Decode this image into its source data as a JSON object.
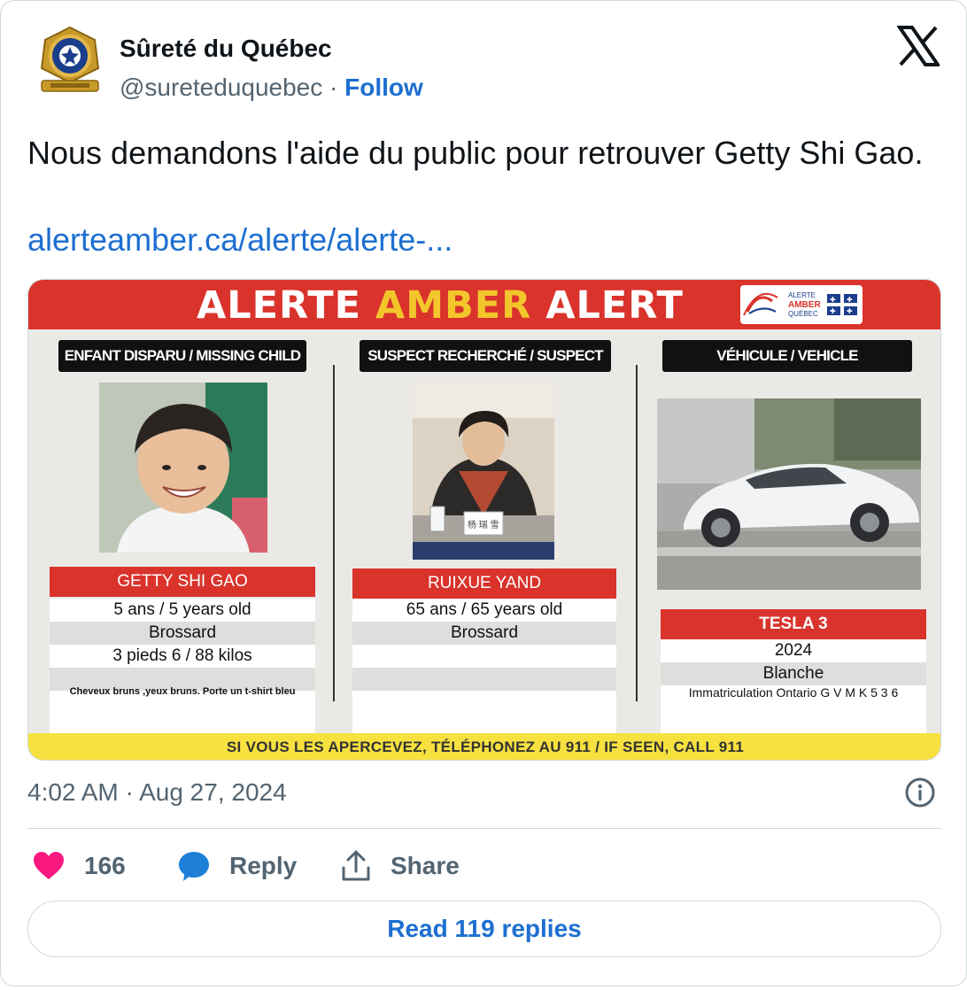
{
  "author": {
    "name": "Sûreté du Québec",
    "handle": "@sureteduquebec",
    "separator": "·",
    "follow_label": "Follow"
  },
  "tweet": {
    "text": "Nous demandons l'aide du public pour retrouver Getty Shi Gao.",
    "link": "alerteamber.ca/alerte/alerte-..."
  },
  "poster": {
    "title_part1": "ALERTE ",
    "title_part2": "AMBER",
    "title_part3": " ALERT",
    "logo_line1": "ALERTE",
    "logo_line2": "AMBER",
    "logo_line3": "QUÉBEC",
    "child": {
      "heading": "ENFANT DISPARU / MISSING CHILD",
      "name": "GETTY SHI GAO",
      "age": "5 ans / 5 years old",
      "city": "Brossard",
      "size": "3 pieds 6 / 88 kilos",
      "description": "Cheveux bruns ,yeux bruns. Porte un t-shirt bleu"
    },
    "suspect": {
      "heading": "SUSPECT RECHERCHÉ / SUSPECT",
      "name": "RUIXUE YAND",
      "age": "65 ans / 65 years old",
      "city": "Brossard",
      "nameplate": "杨 瑞 雪"
    },
    "vehicle": {
      "heading": "VÉHICULE / VEHICLE",
      "model": "TESLA 3",
      "year": "2024",
      "color": "Blanche",
      "plate": "Immatriculation Ontario G V M K 5 3 6"
    },
    "footer": "SI VOUS LES APERCEVEZ, TÉLÉPHONEZ AU 911 / IF SEEN, CALL 911"
  },
  "meta": {
    "timestamp": "4:02 AM · Aug 27, 2024"
  },
  "actions": {
    "like_count": "166",
    "reply_label": "Reply",
    "share_label": "Share",
    "read_replies_label": "Read 119 replies"
  },
  "colors": {
    "link_blue": "#1d6fd1",
    "heart_pink": "#f91880",
    "alert_red": "#d9332c",
    "amber_yellow": "#f3c62c",
    "footer_yellow": "#f6e13f"
  },
  "icons": {
    "brand": "x-logo-icon",
    "like": "heart-icon",
    "reply": "speech-bubble-icon",
    "share": "share-upload-icon",
    "info": "info-icon"
  }
}
